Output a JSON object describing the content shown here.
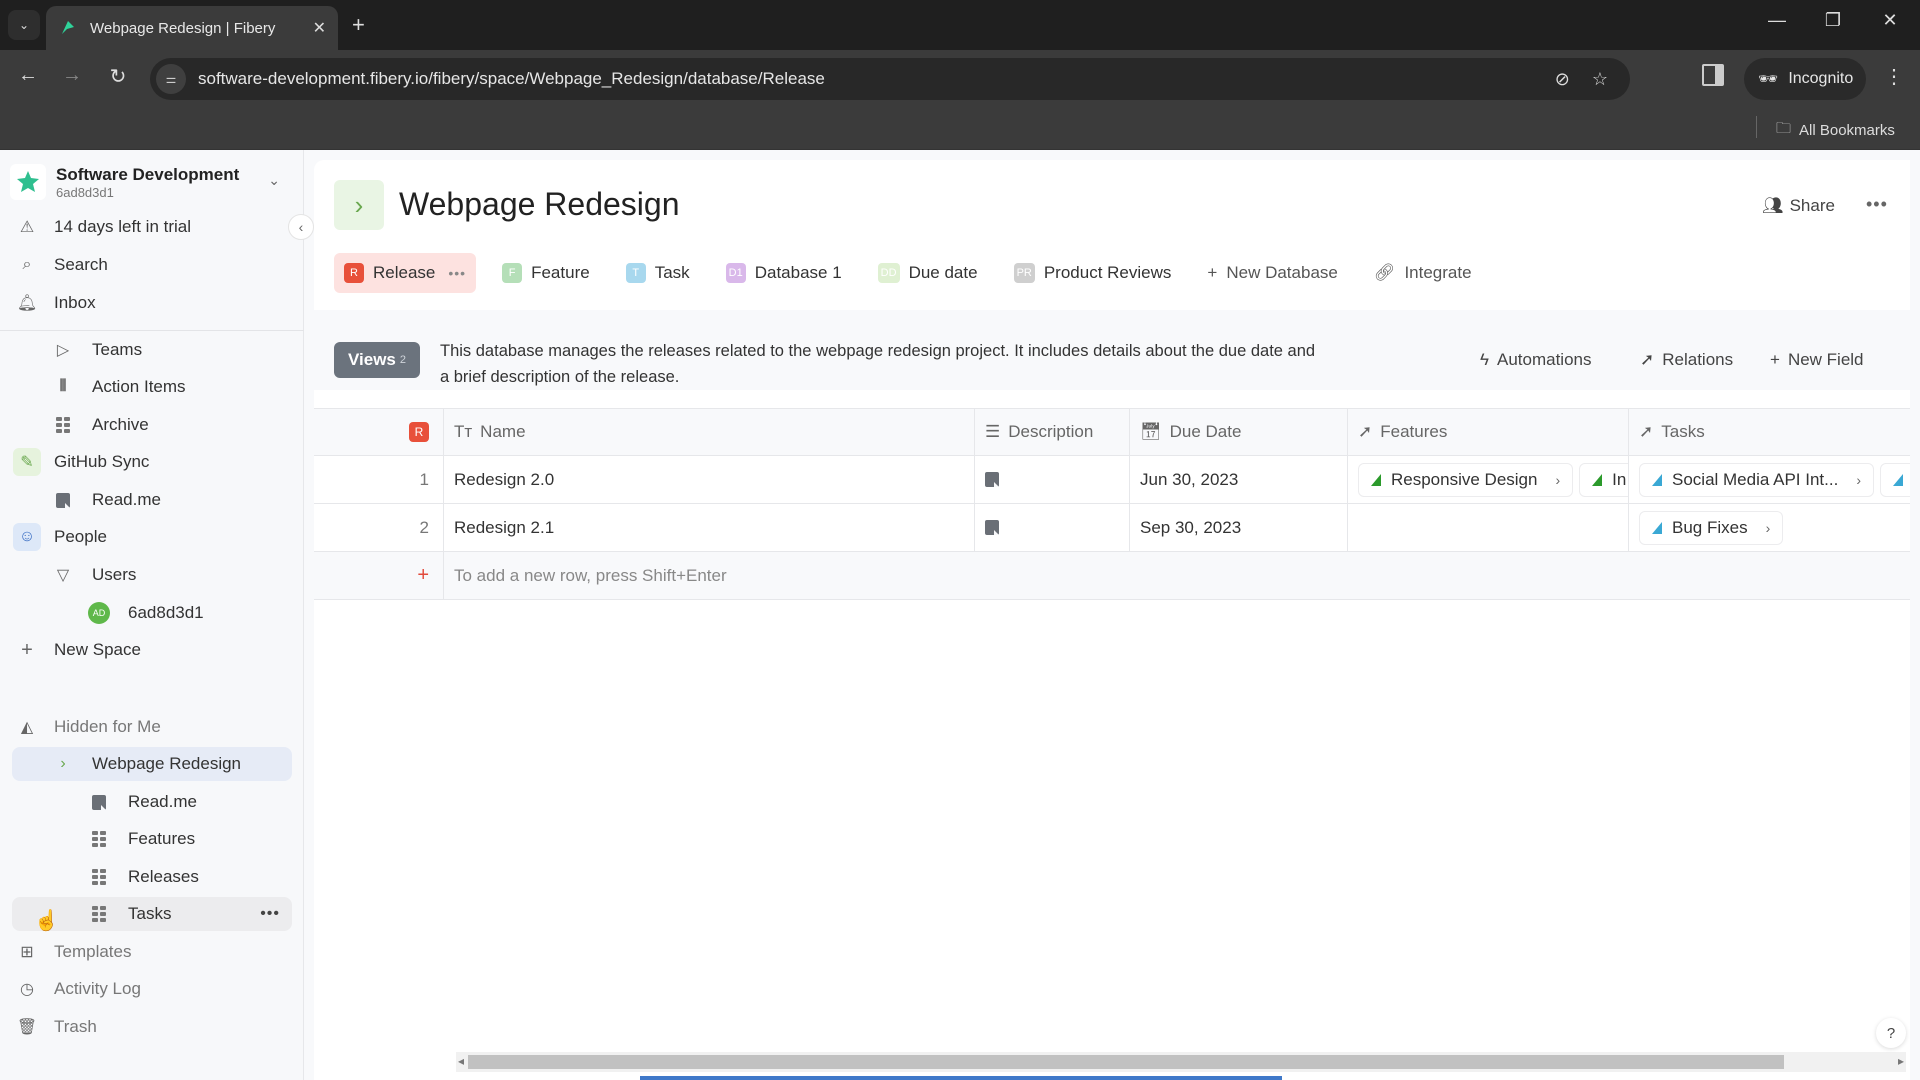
{
  "browser": {
    "tab_title": "Webpage Redesign | Fibery",
    "url": "software-development.fibery.io/fibery/space/Webpage_Redesign/database/Release",
    "profile_label": "Incognito",
    "bookmarks_label": "All Bookmarks"
  },
  "workspace": {
    "name": "Software Development",
    "id": "6ad8d3d1"
  },
  "sidebar": {
    "trial": "14 days left in trial",
    "search": "Search",
    "inbox": "Inbox",
    "items": [
      {
        "label": "Teams",
        "icon": "play-outline-icon"
      },
      {
        "label": "Action Items",
        "icon": "board-icon"
      },
      {
        "label": "Archive",
        "icon": "grid-icon"
      },
      {
        "label": "GitHub Sync",
        "icon": "github-sync-space-icon"
      },
      {
        "label": "Read.me",
        "icon": "document-icon"
      },
      {
        "label": "People",
        "icon": "people-space-icon"
      },
      {
        "label": "Users",
        "icon": "triangle-down-icon"
      },
      {
        "label": "6ad8d3d1",
        "icon": "avatar",
        "avatar_initials": "AD"
      },
      {
        "label": "New Space",
        "icon": "plus-icon"
      }
    ],
    "hidden_section": "Hidden for Me",
    "hidden_items": [
      {
        "label": "Webpage Redesign",
        "icon": "chevron-right-icon"
      },
      {
        "label": "Read.me",
        "icon": "document-icon"
      },
      {
        "label": "Features",
        "icon": "grid-icon"
      },
      {
        "label": "Releases",
        "icon": "grid-icon"
      },
      {
        "label": "Tasks",
        "icon": "grid-icon"
      }
    ],
    "footer": [
      {
        "label": "Templates",
        "icon": "templates-icon"
      },
      {
        "label": "Activity Log",
        "icon": "clock-icon"
      },
      {
        "label": "Trash",
        "icon": "trash-icon"
      }
    ]
  },
  "page": {
    "title": "Webpage Redesign",
    "share": "Share",
    "db_tabs": [
      {
        "label": "Release",
        "badge": "R",
        "color": "#e8503a",
        "active": true
      },
      {
        "label": "Feature",
        "badge": "F",
        "color": "#b5dfb8"
      },
      {
        "label": "Task",
        "badge": "T",
        "color": "#a8d8ee"
      },
      {
        "label": "Database 1",
        "badge": "D1",
        "color": "#d9b8ea"
      },
      {
        "label": "Due date",
        "badge": "DD",
        "color": "#dff0d2"
      },
      {
        "label": "Product Reviews",
        "badge": "PR",
        "color": "#cfcfcf"
      }
    ],
    "new_database": "New Database",
    "integrate": "Integrate"
  },
  "db_toolbar": {
    "views_label": "Views",
    "views_count": "2",
    "description": "This database manages the releases related to the webpage redesign project. It includes details about the due date and a brief description of the release.",
    "automations": "Automations",
    "relations": "Relations",
    "new_field": "New Field"
  },
  "table": {
    "entity_badge": "R",
    "columns": [
      "Name",
      "Description",
      "Due Date",
      "Features",
      "Tasks"
    ],
    "rows": [
      {
        "num": "1",
        "name": "Redesign 2.0",
        "due": "Jun 30, 2023",
        "features": [
          "Responsive Design",
          "In"
        ],
        "tasks": [
          "Social Media API Int..."
        ]
      },
      {
        "num": "2",
        "name": "Redesign 2.1",
        "due": "Sep 30, 2023",
        "features": [],
        "tasks": [
          "Bug Fixes"
        ]
      }
    ],
    "add_row_hint": "To add a new row, press Shift+Enter"
  },
  "colors": {
    "accent_release": "#e8503a",
    "feature_green": "#2b9a2b",
    "task_blue": "#3aa8d4"
  }
}
